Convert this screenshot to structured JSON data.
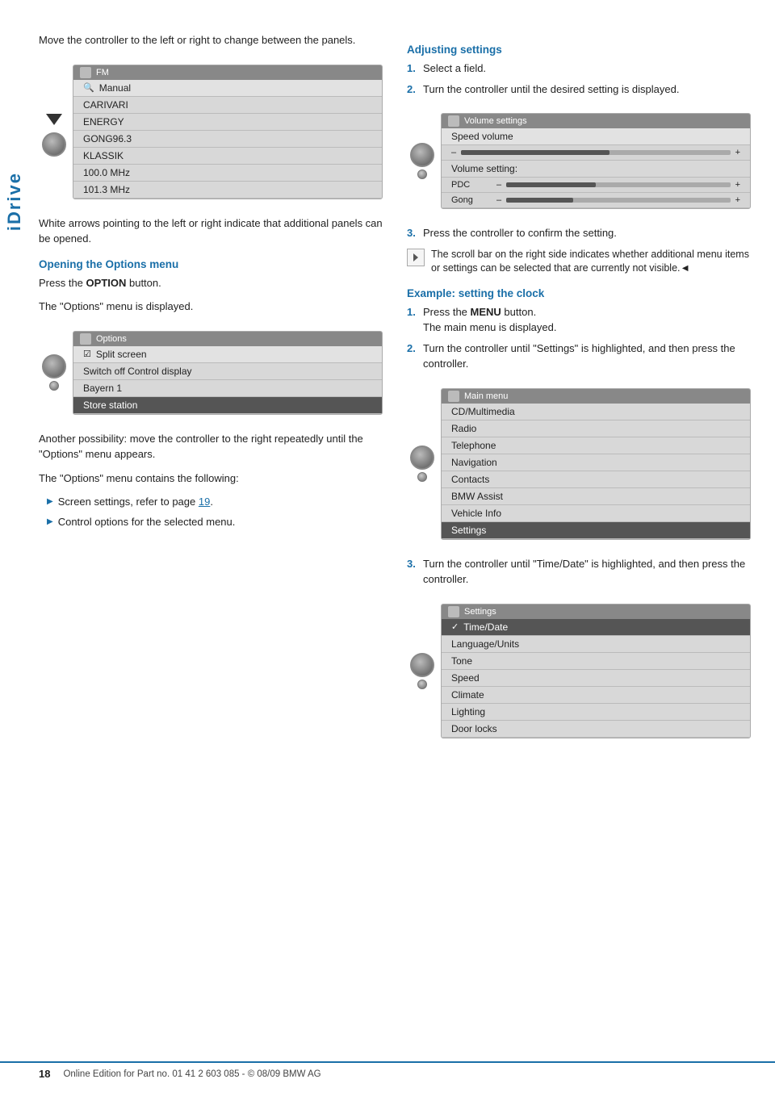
{
  "sidebar": {
    "label": "iDrive"
  },
  "left_col": {
    "intro_para": "Move the controller to the left or right to change between the panels.",
    "screen1": {
      "title": "FM",
      "rows": [
        {
          "text": "Manual",
          "style": "light"
        },
        {
          "text": "CARIVARI",
          "style": "normal"
        },
        {
          "text": "ENERGY",
          "style": "normal"
        },
        {
          "text": "GONG96.3",
          "style": "normal"
        },
        {
          "text": "KLASSIK",
          "style": "normal"
        },
        {
          "text": "100.0 MHz",
          "style": "normal"
        },
        {
          "text": "101.3 MHz",
          "style": "normal"
        }
      ]
    },
    "arrows_note": "White arrows pointing to the left or right indicate that additional panels can be opened.",
    "options_heading": "Opening the Options menu",
    "options_step1": "Press the ",
    "options_step1_bold": "OPTION",
    "options_step1_end": " button.",
    "options_step2": "The \"Options\" menu is displayed.",
    "screen2": {
      "title": "Options",
      "rows": [
        {
          "text": "Split screen",
          "style": "light",
          "has_check": true
        },
        {
          "text": "Switch off Control display",
          "style": "normal"
        },
        {
          "text": "Bayern 1",
          "style": "normal"
        },
        {
          "text": "Store station",
          "style": "selected"
        }
      ]
    },
    "another_para": "Another possibility: move the controller to the right repeatedly until the \"Options\" menu appears.",
    "contains_para": "The \"Options\" menu contains the following:",
    "bullet1": "Screen settings, refer to page ",
    "bullet1_link": "19",
    "bullet1_end": ".",
    "bullet2": "Control options for the selected menu."
  },
  "right_col": {
    "adjusting_heading": "Adjusting settings",
    "step1": "Select a field.",
    "step2": "Turn the controller until the desired setting is displayed.",
    "screen3": {
      "title": "Volume settings",
      "speed_volume_label": "Speed volume",
      "bars": [
        {
          "label": "–",
          "fill": 55,
          "plus": "+"
        },
        {
          "label": "Volume setting:",
          "fill": 0,
          "plus": ""
        },
        {
          "label": "PDC",
          "fill": 40,
          "plus": "+"
        },
        {
          "label": "Gong",
          "fill": 30,
          "plus": "+"
        }
      ]
    },
    "step3": "Press the controller to confirm the setting.",
    "scroll_note": "The scroll bar on the right side indicates whether additional menu items or settings can be selected that are currently not visible.",
    "back_symbol": "◄",
    "example_heading": "Example: setting the clock",
    "ex_step1_pre": "Press the ",
    "ex_step1_bold": "MENU",
    "ex_step1_post": " button.",
    "ex_step1_sub": "The main menu is displayed.",
    "ex_step2": "Turn the controller until \"Settings\" is highlighted, and then press the controller.",
    "screen4": {
      "title": "Main menu",
      "rows": [
        {
          "text": "CD/Multimedia",
          "style": "normal"
        },
        {
          "text": "Radio",
          "style": "normal"
        },
        {
          "text": "Telephone",
          "style": "normal"
        },
        {
          "text": "Navigation",
          "style": "normal"
        },
        {
          "text": "Contacts",
          "style": "normal"
        },
        {
          "text": "BMW Assist",
          "style": "normal"
        },
        {
          "text": "Vehicle Info",
          "style": "normal"
        },
        {
          "text": "Settings",
          "style": "selected"
        }
      ]
    },
    "ex_step3": "Turn the controller until \"Time/Date\" is highlighted, and then press the controller.",
    "screen5": {
      "title": "Settings",
      "rows": [
        {
          "text": "Time/Date",
          "style": "selected",
          "has_check": true
        },
        {
          "text": "Language/Units",
          "style": "normal"
        },
        {
          "text": "Tone",
          "style": "normal"
        },
        {
          "text": "Speed",
          "style": "normal"
        },
        {
          "text": "Climate",
          "style": "normal"
        },
        {
          "text": "Lighting",
          "style": "normal"
        },
        {
          "text": "Door locks",
          "style": "normal"
        }
      ]
    }
  },
  "footer": {
    "page_number": "18",
    "text": "Online Edition for Part no. 01 41 2 603 085 - © 08/09 BMW AG"
  }
}
